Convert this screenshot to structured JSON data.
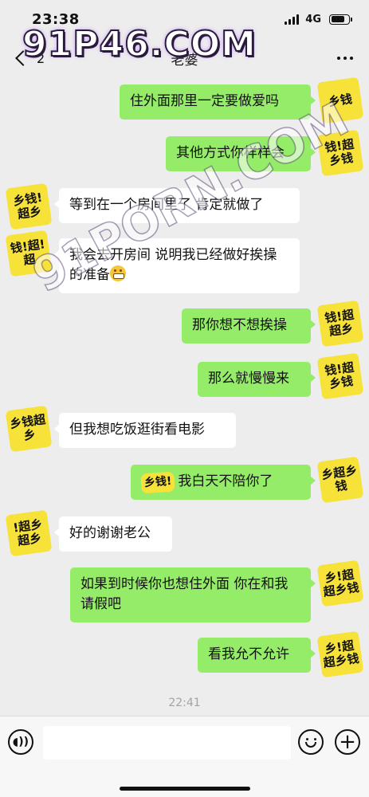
{
  "status_bar": {
    "time": "23:38",
    "network": "4G",
    "battery_level": 0.8
  },
  "nav": {
    "unread_count": "2",
    "title": "老婆",
    "back_icon": "chevron-left-icon",
    "more_icon": "more-dots-icon"
  },
  "watermarks": {
    "top": "91P46.COM",
    "diagonal": "91PORN.COM"
  },
  "messages": [
    {
      "side": "out",
      "text": "住外面那里一定要做爱吗",
      "avatar_text": "乡钱"
    },
    {
      "side": "out",
      "text": "其他方式你样样会",
      "avatar_text": "钱!超乡钱"
    },
    {
      "side": "in",
      "text": "等到在一个房间里了 肯定就做了",
      "avatar_text": "乡钱!超乡"
    },
    {
      "side": "in",
      "text": "我会去开房间 说明我已经做好挨操的准备",
      "avatar_text": "钱!超!超"
    },
    {
      "side": "out",
      "text": "那你想不想挨操",
      "avatar_text": "钱!超超乡"
    },
    {
      "side": "out",
      "text": "那么就慢慢来",
      "avatar_text": "钱!超乡钱"
    },
    {
      "side": "in",
      "text": "但我想吃饭逛街看电影",
      "avatar_text": "乡钱超乡"
    },
    {
      "side": "out",
      "text": "我白天不陪你了",
      "sticker_text": "乡钱!",
      "avatar_text": "乡超乡钱"
    },
    {
      "side": "in",
      "text": "好的谢谢老公",
      "avatar_text": "!超乡超乡"
    },
    {
      "side": "out",
      "text": "如果到时候你也想住外面 你在和我请假吧",
      "avatar_text": "乡!超超乡钱"
    },
    {
      "side": "out",
      "text": "看我允不允许",
      "avatar_text": "乡!超超乡钱"
    }
  ],
  "time_divider": "22:41",
  "input_bar": {
    "voice_icon": "voice-icon",
    "emoji_icon": "emoji-face-icon",
    "plus_icon": "plus-circle-icon",
    "placeholder": ""
  }
}
